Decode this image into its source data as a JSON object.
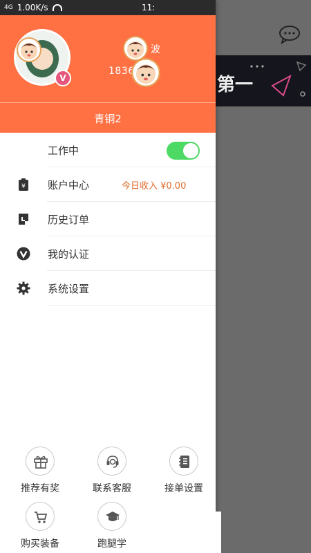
{
  "status_bar": {
    "signal": "4G",
    "speed": "1.00K/s",
    "time": "11:"
  },
  "background": {
    "banner_text": "第一"
  },
  "profile": {
    "name": "波",
    "phone": "1836    035",
    "badge": "V",
    "level": "青铜2"
  },
  "menu": {
    "items": [
      {
        "icon": "none",
        "label": "工作中",
        "extra": "",
        "toggle": true
      },
      {
        "icon": "wallet-icon",
        "label": "账户中心",
        "extra": "今日收入 ¥0.00"
      },
      {
        "icon": "order-history-icon",
        "label": "历史订单",
        "extra": ""
      },
      {
        "icon": "verification-icon",
        "label": "我的认证",
        "extra": ""
      },
      {
        "icon": "gear-icon",
        "label": "系统设置",
        "extra": ""
      }
    ]
  },
  "shortcuts": [
    {
      "icon": "gift-icon",
      "label": "推荐有奖"
    },
    {
      "icon": "headset-icon",
      "label": "联系客服"
    },
    {
      "icon": "notebook-icon",
      "label": "接单设置"
    },
    {
      "icon": "cart-icon",
      "label": "购买装备"
    },
    {
      "icon": "graduation-cap-icon",
      "label": "跑腿学"
    }
  ],
  "colors": {
    "brand": "#ff7043",
    "toggle_on": "#4cd964",
    "income": "#e06a2a",
    "badge": "#e5577c"
  }
}
